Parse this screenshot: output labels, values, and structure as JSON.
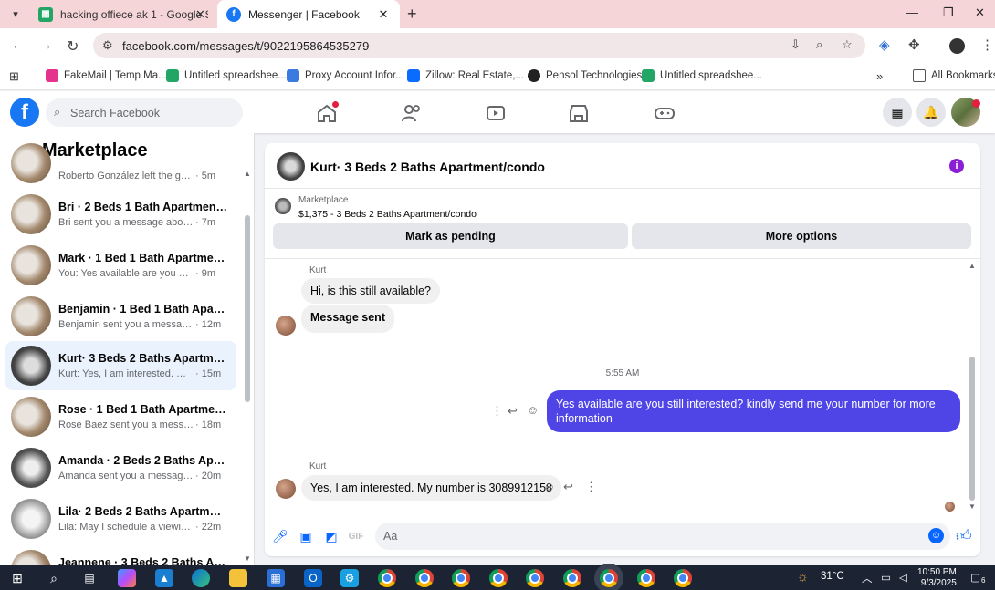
{
  "browser": {
    "tabs": [
      {
        "title": "hacking offiece ak 1 - Google S",
        "favicon": "sheets-icon"
      },
      {
        "title": "Messenger | Facebook",
        "favicon": "facebook-icon"
      }
    ],
    "url": "facebook.com/messages/t/9022195864535279",
    "bookmarks": [
      "FakeMail | Temp Ma...",
      "Untitled spreadshee...",
      "Proxy Account Infor...",
      "Zillow: Real Estate,...",
      "Pensol Technologies",
      "Untitled spreadshee..."
    ],
    "all_bookmarks": "All Bookmarks"
  },
  "facebook": {
    "search_placeholder": "Search Facebook",
    "logo": "f"
  },
  "marketplace": {
    "title": "Marketplace",
    "conversations": [
      {
        "name": "",
        "preview": "Roberto González left the group.",
        "time": "· 5m",
        "active": false
      },
      {
        "name": "Bri · 2 Beds 1 Bath Apartment/c...",
        "preview": "Bri sent you a message about your...",
        "time": "· 7m",
        "active": false
      },
      {
        "name": "Mark · 1 Bed 1 Bath Apartment/...",
        "preview": "You: Yes available are you still inter...",
        "time": "· 9m",
        "active": false
      },
      {
        "name": "Benjamin · 1 Bed 1 Bath Apartm...",
        "preview": "Benjamin sent you a message ab...",
        "time": "· 12m",
        "active": false
      },
      {
        "name": "Kurt· 3 Beds 2 Baths Apartment...",
        "preview": "Kurt: Yes, I am interested. My nu...",
        "time": "· 15m",
        "active": true
      },
      {
        "name": "Rose · 1 Bed 1 Bath Apartment/c...",
        "preview": "Rose Baez sent you a message a...",
        "time": "· 18m",
        "active": false
      },
      {
        "name": "Amanda · 2 Beds 2 Baths Apart...",
        "preview": "Amanda sent you a message abo...",
        "time": "· 20m",
        "active": false
      },
      {
        "name": "Lila· 2 Beds 2 Baths Apartment/...",
        "preview": "Lila: May I schedule a viewing for...",
        "time": "· 22m",
        "active": false
      },
      {
        "name": "Jeannene · 3 Beds 2 Baths Apart...",
        "preview": "",
        "time": "",
        "active": false
      }
    ]
  },
  "chat": {
    "title": "Kurt· 3 Beds 2 Baths Apartment/condo",
    "listing_source": "Marketplace",
    "listing_desc": "$1,375 - 3 Beds 2 Baths Apartment/condo",
    "mark_pending": "Mark as pending",
    "more_options": "More options",
    "sender_name": "Kurt",
    "msg1": "Hi, is this still available?",
    "msg2": "Message sent",
    "timestamp": "5:55 AM",
    "msg_out": "Yes available are you still interested? kindly send me your number for more information",
    "sender_name2": "Kurt",
    "msg3": "Yes, I am interested. My number is 3089912158",
    "composer_placeholder": "Aa"
  },
  "taskbar": {
    "weather": "31°C",
    "time": "10:50 PM",
    "date": "9/3/2025",
    "notif_count": "6"
  },
  "colors": {
    "fb_blue": "#1877f2",
    "outgoing_bubble": "#4f45e6",
    "active_conv": "#eaf2fd"
  }
}
